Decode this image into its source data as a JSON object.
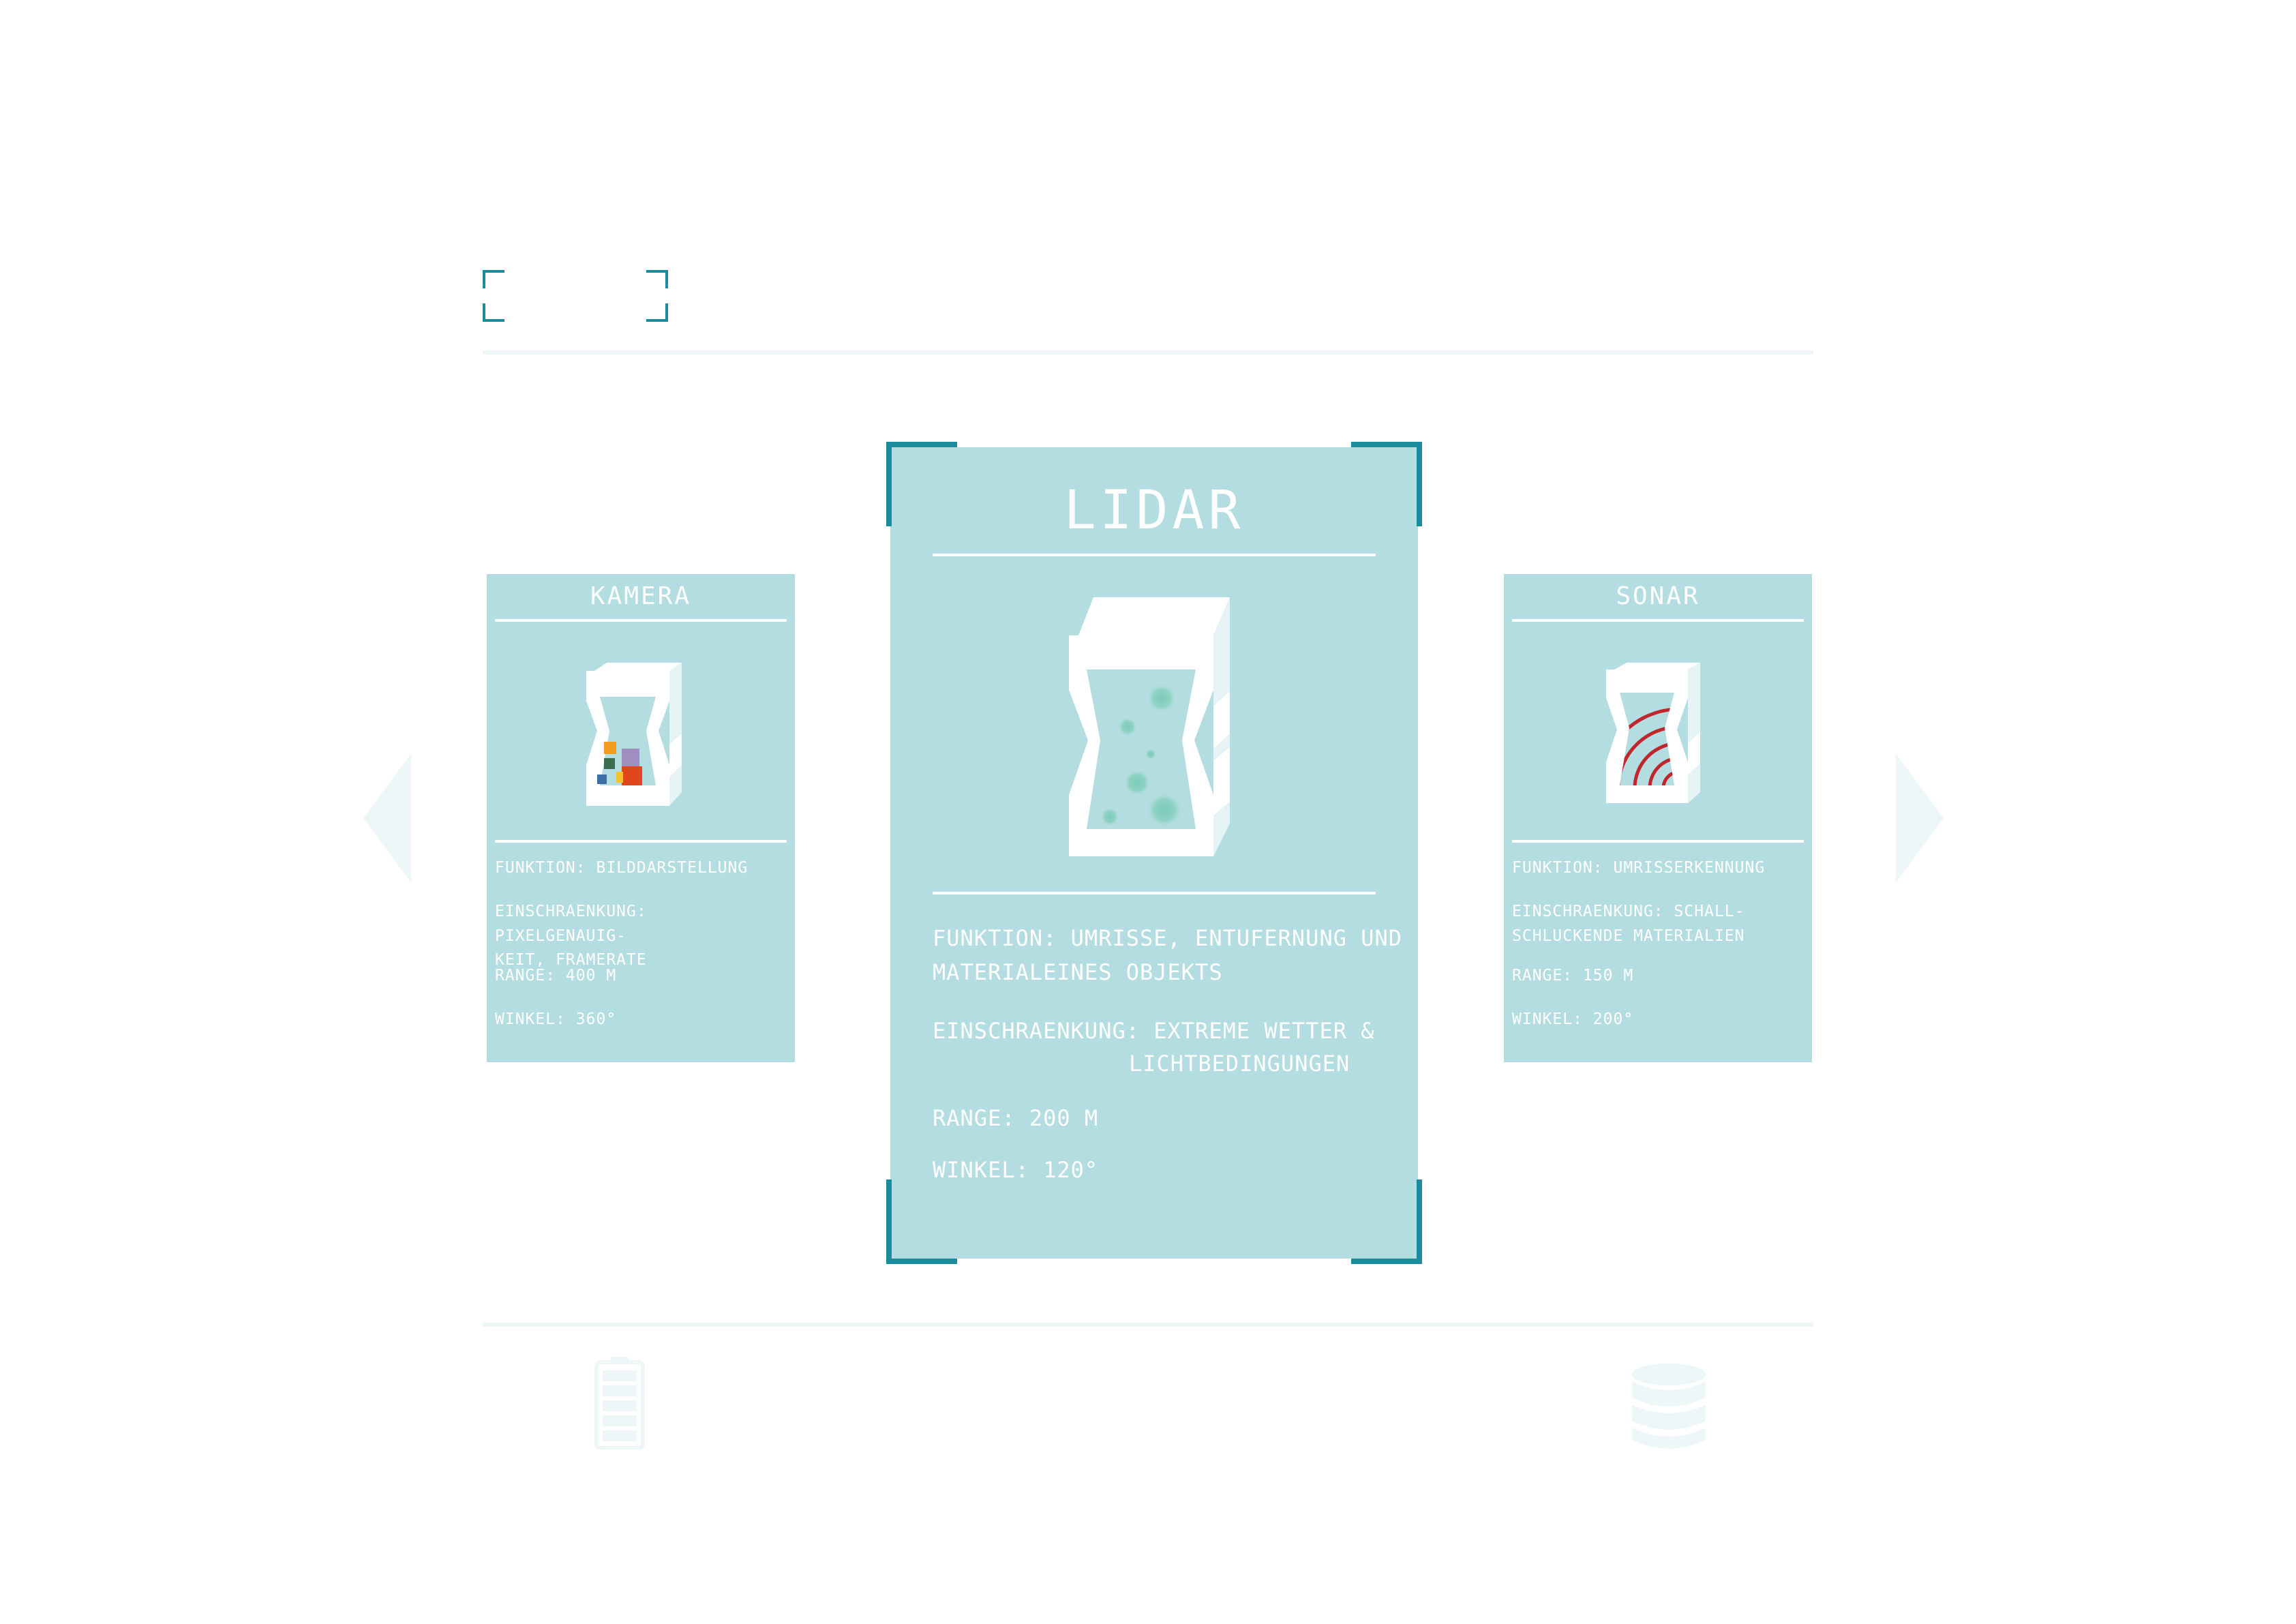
{
  "colors": {
    "accent": "#1a8c9b",
    "card": "#b4dde1",
    "faint": "#eef7f8",
    "sonar_wave": "#c0272d"
  },
  "nav": {
    "prev_icon": "triangle-left-icon",
    "next_icon": "triangle-right-icon"
  },
  "cards": {
    "kamera": {
      "title": "Kamera",
      "icon": "camera-sensor-icon",
      "funktion": "Funktion: Bilddarstellung",
      "einschraenkung": "Einschraenkung: Pixelgenauig-\nkeit, Framerate",
      "range": "Range: 400 m",
      "winkel": "Winkel: 360°"
    },
    "lidar": {
      "title": "Lidar",
      "icon": "lidar-sensor-icon",
      "funktion": "Funktion: Umrisse, Entufernung und\nMaterialeines Objekts",
      "einschraenkung_label": "Einschraenkung: Extreme Wetter &",
      "einschraenkung_cont": "Lichtbedingungen",
      "range": "Range: 200 m",
      "winkel": "Winkel: 120°"
    },
    "sonar": {
      "title": "Sonar",
      "icon": "sonar-sensor-icon",
      "funktion": "Funktion: Umrisserkennung",
      "einschraenkung": "Einschraenkung: Schall-\nschluckende Materialien",
      "range": "Range: 150 m",
      "winkel": "Winkel: 200°"
    }
  },
  "footer": {
    "left_icon": "battery-icon",
    "right_icon": "database-icon"
  }
}
